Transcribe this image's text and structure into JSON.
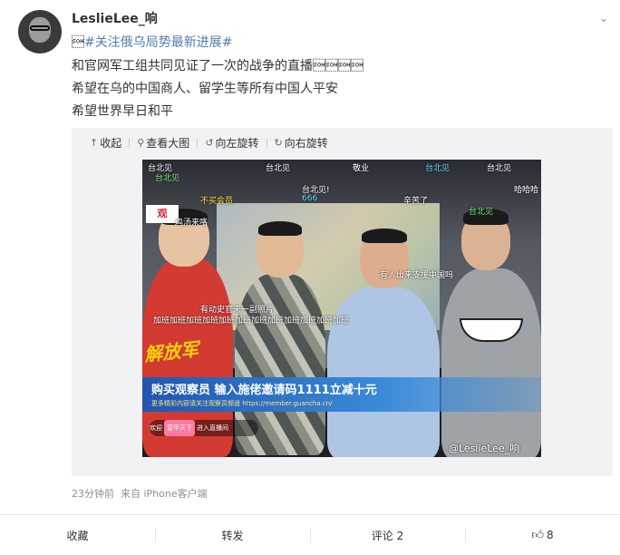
{
  "post": {
    "username": "LeslieLee_响",
    "hashtag_prefix": "\u0001",
    "hashtag": "#关注俄乌局势最新进展#",
    "line1": "和官网军工组共同见证了一次的战争的直播\u0001\u0001\u0001\u0001",
    "line2": "希望在乌的中国商人、留学生等所有中国人平安",
    "line3": "希望世界早日和平",
    "meta_time": "23分钟前",
    "meta_source": "来自 iPhone客户端"
  },
  "toolbar": {
    "collapse": "收起",
    "view_large": "查看大图",
    "rotate_left": "向左旋转",
    "rotate_right": "向右旋转"
  },
  "video": {
    "banner_title": "购买观察员  输入施佬邀请码1111立减十元",
    "banner_sub": "更多精彩内容请关注观察员频道 https://member.guancha.cn/",
    "join_text": "欢迎",
    "join_badge": "富甲天下",
    "join_suffix": "进入直播间",
    "watermark": "@LeslieLee_响",
    "overlay_chars": "解放军",
    "logo": "观",
    "danmaku": [
      {
        "text": "台北见",
        "cls": ""
      },
      {
        "text": "台北见",
        "cls": "dm-green"
      },
      {
        "text": "台北见",
        "cls": ""
      },
      {
        "text": "台北见!",
        "cls": ""
      },
      {
        "text": "敬业",
        "cls": ""
      },
      {
        "text": "台北见",
        "cls": "dm-cyan"
      },
      {
        "text": "666",
        "cls": "dm-cyan"
      },
      {
        "text": "不买会员",
        "cls": "dm-yellow"
      },
      {
        "text": "哈哈哈",
        "cls": ""
      },
      {
        "text": "辛苦了",
        "cls": ""
      },
      {
        "text": "鸡汤来咯",
        "cls": ""
      },
      {
        "text": "有人出来支援中国吗",
        "cls": ""
      },
      {
        "text": "加班加班加班加班加班加班加班加班加班加班加班加班",
        "cls": ""
      },
      {
        "text": "有动史官来一副照片",
        "cls": ""
      },
      {
        "text": "台北见",
        "cls": ""
      },
      {
        "text": "台北见",
        "cls": "dm-green"
      }
    ]
  },
  "actions": {
    "favorite": "收藏",
    "repost": "转发",
    "comment": "评论 2",
    "like_count": "8"
  },
  "colors": {
    "hashtag": "#507daf",
    "meta": "#8f8f8f",
    "banner": "#2156b0"
  }
}
